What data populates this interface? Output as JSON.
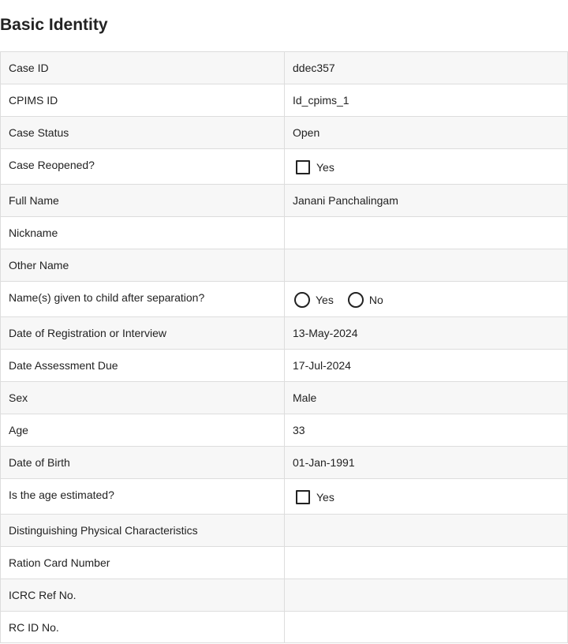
{
  "section": {
    "title": "Basic Identity"
  },
  "fields": {
    "case_id": {
      "label": "Case ID",
      "value": "ddec357"
    },
    "cpims_id": {
      "label": "CPIMS ID",
      "value": "Id_cpims_1"
    },
    "case_status": {
      "label": "Case Status",
      "value": "Open"
    },
    "case_reopened": {
      "label": "Case Reopened?",
      "option": "Yes"
    },
    "full_name": {
      "label": "Full Name",
      "value": "Janani Panchalingam"
    },
    "nickname": {
      "label": "Nickname",
      "value": ""
    },
    "other_name": {
      "label": "Other Name",
      "value": ""
    },
    "name_after_separation": {
      "label": "Name(s) given to child after separation?",
      "option_yes": "Yes",
      "option_no": "No"
    },
    "registration_date": {
      "label": "Date of Registration or Interview",
      "value": "13-May-2024"
    },
    "assessment_due": {
      "label": "Date Assessment Due",
      "value": "17-Jul-2024"
    },
    "sex": {
      "label": "Sex",
      "value": "Male"
    },
    "age": {
      "label": "Age",
      "value": "33"
    },
    "dob": {
      "label": "Date of Birth",
      "value": "01-Jan-1991"
    },
    "age_estimated": {
      "label": "Is the age estimated?",
      "option": "Yes"
    },
    "physical_characteristics": {
      "label": "Distinguishing Physical Characteristics",
      "value": ""
    },
    "ration_card": {
      "label": "Ration Card Number",
      "value": ""
    },
    "icrc_ref": {
      "label": "ICRC Ref No.",
      "value": ""
    },
    "rc_id": {
      "label": "RC ID No.",
      "value": ""
    }
  }
}
